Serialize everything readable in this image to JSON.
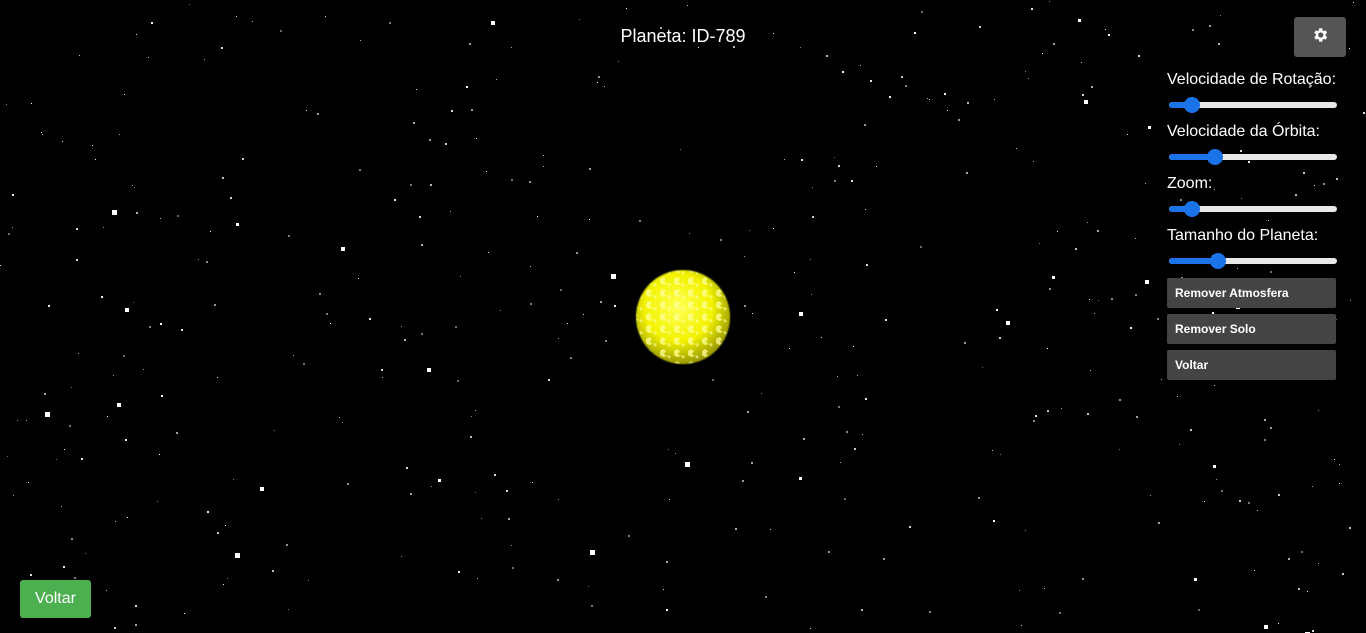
{
  "header": {
    "title": "Planeta: ID-789"
  },
  "settings": {
    "icon": "gear-icon"
  },
  "controls": [
    {
      "label": "Velocidade de Rotação:",
      "value": 0.1
    },
    {
      "label": "Velocidade da Órbita:",
      "value": 0.25
    },
    {
      "label": "Zoom:",
      "value": 0.1
    },
    {
      "label": "Tamanho do Planeta:",
      "value": 0.27
    }
  ],
  "buttons": {
    "remove_atmosphere": "Remover Atmosfera",
    "remove_soil": "Remover Solo",
    "back_panel": "Voltar",
    "back_main": "Voltar"
  },
  "planet": {
    "color": "#ffff00"
  },
  "colors": {
    "accent": "#1a73e8",
    "back_button": "#4caf50",
    "panel_button": "#444444"
  }
}
